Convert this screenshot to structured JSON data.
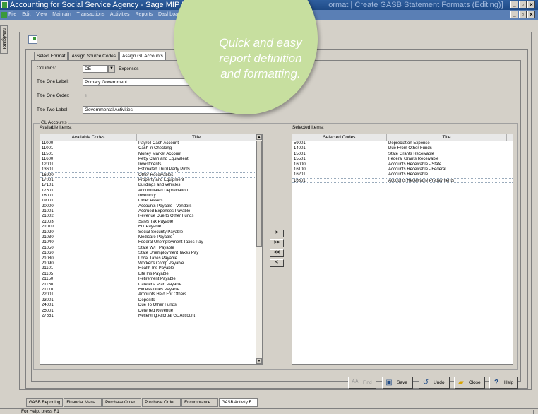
{
  "window": {
    "title_left": "Accounting for Social Service Agency - Sage MIP Fund Accou",
    "title_right": "ormat | Create GASB Statement Formats (Editing)]"
  },
  "menu": [
    "File",
    "Edit",
    "View",
    "Maintain",
    "Transactions",
    "Activities",
    "Reports",
    "Dashboard",
    "O"
  ],
  "navigator_label": "Navigator",
  "tabs": [
    "Select Format",
    "Assign Source Codes",
    "Assign GL Accounts"
  ],
  "form": {
    "columns_label": "Columns:",
    "columns_value": "DE",
    "columns_desc": "Expenses",
    "title_one_label": "Title One Label:",
    "title_one_value": "Primary Government",
    "title_one_order_label": "Title One Order:",
    "title_one_order_value": "1",
    "title_two_label": "Title Two Label:",
    "title_two_value": "Governmental Activities"
  },
  "gl_accounts": {
    "group_label": "GL Accounts",
    "available_label": "Available Items:",
    "selected_label": "Selected Items:",
    "available_headers": [
      "Available Codes",
      "Title"
    ],
    "selected_headers": [
      "Selected Codes",
      "Title"
    ],
    "available_rows": [
      [
        "11000",
        "Payroll Cash Account"
      ],
      [
        "11001",
        "Cash in Checking"
      ],
      [
        "11501",
        "Money Market Account"
      ],
      [
        "11600",
        "Petty Cash and Equivalent"
      ],
      [
        "12001",
        "Investments"
      ],
      [
        "13601",
        "Estimated Third Party Pmts"
      ],
      [
        "16900",
        "Other Receivables"
      ],
      [
        "17001",
        "Property and Equipment"
      ],
      [
        "17101",
        "Buildings and vehicles"
      ],
      [
        "17501",
        "Accumulated Depreciation"
      ],
      [
        "18001",
        "Inventory"
      ],
      [
        "19001",
        "Other Assets"
      ],
      [
        "20000",
        "Accounts Payable - Vendors"
      ],
      [
        "21001",
        "Accrued Expenses Payable"
      ],
      [
        "21002",
        "Revenue Due to Other Funds"
      ],
      [
        "21003",
        "Sales Tax Payable"
      ],
      [
        "21010",
        "FIT Payable"
      ],
      [
        "21020",
        "Social Security Payable"
      ],
      [
        "21030",
        "Medicare Payable"
      ],
      [
        "21040",
        "Federal Unemployment Taxes Pay"
      ],
      [
        "21050",
        "State W/H Payable"
      ],
      [
        "21060",
        "State Unemployment Taxes Pay"
      ],
      [
        "21080",
        "Local Taxes Payable"
      ],
      [
        "21090",
        "Worker's Comp Payable"
      ],
      [
        "21101",
        "Health Ins Payable"
      ],
      [
        "21105",
        "Life Ins Payable"
      ],
      [
        "21150",
        "Retirement Payable"
      ],
      [
        "21160",
        "Cafeteria Plan Payable"
      ],
      [
        "21170",
        "Fitness Dues Payable"
      ],
      [
        "22001",
        "Amounts Held For Others"
      ],
      [
        "23001",
        "Deposits"
      ],
      [
        "24001",
        "Due To Other Funds"
      ],
      [
        "25001",
        "Deferred Revenue"
      ],
      [
        "27551",
        "Receiving Accrual GL Account"
      ]
    ],
    "selected_rows": [
      [
        "59001",
        "Depreciation Expense"
      ],
      [
        "14001",
        "Due From Other Funds"
      ],
      [
        "15001",
        "State Grants Receivable"
      ],
      [
        "15501",
        "Federal Grants Receivable"
      ],
      [
        "16000",
        "Accounts Receivable - State"
      ],
      [
        "16100",
        "Accounts Receivable - Federal"
      ],
      [
        "16201",
        "Accounts Receivable"
      ],
      [
        "16301",
        "Accounts Receivable Prepayments"
      ]
    ],
    "move_buttons": [
      ">",
      ">>",
      "<<",
      "<"
    ]
  },
  "actions": {
    "find": "Find",
    "save": "Save",
    "undo": "Undo",
    "close": "Close",
    "help": "Help"
  },
  "doc_tabs": [
    "GASB Reporting",
    "Financial Mana...",
    "Purchase Order...",
    "Purchase Order...",
    "Encumbrance ...",
    "GASB Activity F..."
  ],
  "status_text": "For Help, press F1",
  "callout_text": "Quick and easy report definition and formatting.",
  "colors": {
    "title_bar": "#2f5f9f",
    "callout": "#c7df9f"
  }
}
